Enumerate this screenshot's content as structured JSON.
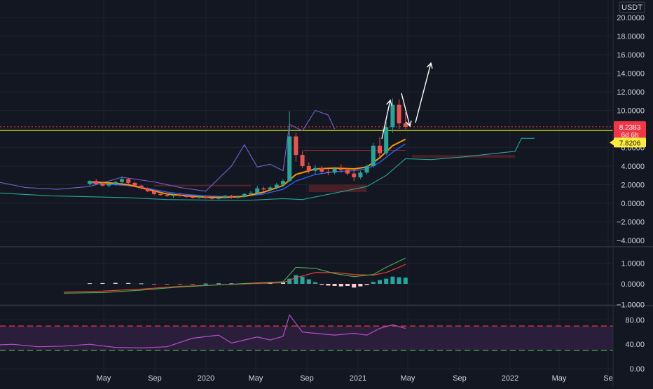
{
  "currency": "USDT",
  "colors": {
    "background": "#131722",
    "grid": "#1e222d",
    "up": "#26a69a",
    "down": "#ef5350",
    "ma": "#ff9800",
    "bb": "#7b61cf",
    "band": "#8b2a2a",
    "baseline": "#cccc00",
    "price_tag": "#f23645",
    "baseline_tag": "#ffeb3b",
    "macd_line": "#4caf50",
    "signal_line": "#f44336",
    "rsi_line": "#b34fc7",
    "rsi_band": "#2a1e3a",
    "rsi_upper": "#f23645",
    "rsi_lower": "#4caf50"
  },
  "time_labels": [
    "May",
    "Sep",
    "2020",
    "May",
    "Sep",
    "2021",
    "May",
    "Sep",
    "2022",
    "May",
    "Se"
  ],
  "price_tag": {
    "value": "8.2383",
    "countdown": "6d 6h"
  },
  "baseline_tag": {
    "value": "7.8206"
  },
  "chart_data": [
    {
      "type": "candlestick",
      "pane": "price",
      "y_ticks": [
        "20.0000",
        "18.0000",
        "16.0000",
        "14.0000",
        "12.0000",
        "10.0000",
        "6.0000",
        "4.0000",
        "2.0000",
        "0.0000",
        "−2.0000",
        "−4.0000"
      ],
      "ylim": [
        -4,
        21
      ],
      "last_price": 8.2383,
      "baseline": 7.8206,
      "candles": [
        [
          0,
          2.1,
          2.5,
          1.9,
          2.4
        ],
        [
          1,
          2.4,
          2.6,
          2.0,
          2.1
        ],
        [
          2,
          2.1,
          2.3,
          1.8,
          1.9
        ],
        [
          3,
          1.9,
          2.2,
          1.7,
          2.1
        ],
        [
          4,
          2.1,
          2.4,
          1.9,
          2.3
        ],
        [
          5,
          2.3,
          2.9,
          2.1,
          2.6
        ],
        [
          6,
          2.6,
          2.7,
          2.0,
          2.2
        ],
        [
          7,
          2.2,
          2.3,
          1.8,
          1.9
        ],
        [
          8,
          1.9,
          2.0,
          1.5,
          1.6
        ],
        [
          9,
          1.6,
          1.7,
          1.2,
          1.3
        ],
        [
          10,
          1.3,
          1.4,
          0.9,
          1.0
        ],
        [
          11,
          1.0,
          1.2,
          0.8,
          0.9
        ],
        [
          12,
          0.9,
          1.1,
          0.7,
          0.8
        ],
        [
          13,
          0.8,
          1.0,
          0.6,
          0.9
        ],
        [
          14,
          0.9,
          1.1,
          0.7,
          0.8
        ],
        [
          15,
          0.8,
          0.9,
          0.6,
          0.7
        ],
        [
          16,
          0.7,
          0.9,
          0.5,
          0.6
        ],
        [
          17,
          0.6,
          0.8,
          0.5,
          0.7
        ],
        [
          18,
          0.7,
          0.8,
          0.5,
          0.6
        ],
        [
          19,
          0.6,
          0.7,
          0.4,
          0.5
        ],
        [
          20,
          0.5,
          0.7,
          0.4,
          0.6
        ],
        [
          21,
          0.6,
          0.9,
          0.5,
          0.8
        ],
        [
          22,
          0.8,
          0.9,
          0.5,
          0.6
        ],
        [
          23,
          0.6,
          0.8,
          0.5,
          0.7
        ],
        [
          24,
          0.7,
          1.1,
          0.6,
          1.0
        ],
        [
          25,
          1.0,
          1.3,
          0.8,
          1.1
        ],
        [
          26,
          1.1,
          1.9,
          1.0,
          1.6
        ],
        [
          27,
          1.6,
          1.8,
          1.3,
          1.5
        ],
        [
          28,
          1.5,
          1.9,
          1.3,
          1.7
        ],
        [
          29,
          1.7,
          2.2,
          1.5,
          2.0
        ],
        [
          30,
          2.0,
          2.6,
          1.8,
          2.4
        ],
        [
          31,
          2.4,
          9.9,
          2.3,
          7.2
        ],
        [
          32,
          7.2,
          7.6,
          4.5,
          5.2
        ],
        [
          33,
          5.2,
          5.6,
          3.8,
          4.0
        ],
        [
          34,
          4.0,
          4.4,
          3.2,
          3.5
        ],
        [
          35,
          3.5,
          4.1,
          3.1,
          3.8
        ],
        [
          36,
          3.8,
          4.0,
          3.2,
          3.4
        ],
        [
          37,
          3.4,
          3.7,
          3.0,
          3.3
        ],
        [
          38,
          3.3,
          3.9,
          3.1,
          3.7
        ],
        [
          39,
          3.7,
          4.2,
          3.3,
          3.6
        ],
        [
          40,
          3.6,
          3.8,
          3.0,
          3.2
        ],
        [
          41,
          3.2,
          3.6,
          2.4,
          2.8
        ],
        [
          42,
          2.8,
          3.5,
          2.6,
          3.3
        ],
        [
          43,
          3.3,
          4.2,
          3.1,
          4.0
        ],
        [
          44,
          4.0,
          6.5,
          3.8,
          6.2
        ],
        [
          45,
          6.2,
          7.1,
          5.0,
          5.4
        ],
        [
          46,
          5.4,
          8.8,
          5.2,
          8.2
        ],
        [
          47,
          8.2,
          11.3,
          7.6,
          10.6
        ],
        [
          48,
          10.6,
          11.2,
          8.0,
          8.6
        ],
        [
          49,
          8.6,
          9.8,
          8.0,
          8.24
        ]
      ],
      "ma": [
        [
          0,
          2.3
        ],
        [
          3,
          2.2
        ],
        [
          6,
          2.0
        ],
        [
          9,
          1.5
        ],
        [
          12,
          1.0
        ],
        [
          15,
          0.8
        ],
        [
          18,
          0.65
        ],
        [
          21,
          0.62
        ],
        [
          24,
          0.75
        ],
        [
          27,
          1.2
        ],
        [
          30,
          1.9
        ],
        [
          32,
          3.1
        ],
        [
          35,
          3.7
        ],
        [
          38,
          3.8
        ],
        [
          41,
          3.7
        ],
        [
          43,
          3.9
        ],
        [
          45,
          4.9
        ],
        [
          47,
          6.2
        ],
        [
          49,
          6.9
        ]
      ],
      "ma2": [
        [
          0,
          2.1
        ],
        [
          3,
          2.05
        ],
        [
          6,
          1.9
        ],
        [
          9,
          1.6
        ],
        [
          12,
          1.2
        ],
        [
          15,
          0.95
        ],
        [
          18,
          0.8
        ],
        [
          21,
          0.72
        ],
        [
          24,
          0.75
        ],
        [
          27,
          1.0
        ],
        [
          30,
          1.5
        ],
        [
          32,
          2.4
        ],
        [
          35,
          3.1
        ],
        [
          38,
          3.4
        ],
        [
          41,
          3.5
        ],
        [
          43,
          3.7
        ],
        [
          45,
          4.4
        ],
        [
          47,
          5.5
        ],
        [
          49,
          6.4
        ]
      ],
      "bb_upper": [
        [
          -24,
          2.1
        ],
        [
          -20,
          1.6
        ],
        [
          -15,
          2.4
        ],
        [
          -10,
          1.7
        ],
        [
          -5,
          1.5
        ],
        [
          0,
          1.8
        ],
        [
          5,
          2.8
        ],
        [
          10,
          2.3
        ],
        [
          14,
          1.7
        ],
        [
          18,
          1.3
        ],
        [
          22,
          4.0
        ],
        [
          24,
          6.3
        ],
        [
          26,
          3.9
        ],
        [
          28,
          4.2
        ],
        [
          30,
          3.5
        ],
        [
          31,
          8.5
        ],
        [
          33,
          7.8
        ],
        [
          35,
          10.0
        ],
        [
          37,
          9.5
        ],
        [
          38,
          8.0
        ]
      ],
      "bb_lower": [
        [
          -14,
          1.1
        ],
        [
          -6,
          0.8
        ],
        [
          0,
          0.7
        ],
        [
          6,
          0.6
        ],
        [
          12,
          0.4
        ],
        [
          18,
          0.35
        ],
        [
          24,
          0.3
        ],
        [
          30,
          0.5
        ],
        [
          33,
          0.4
        ],
        [
          38,
          1.1
        ],
        [
          43,
          1.8
        ],
        [
          46,
          3.0
        ],
        [
          49,
          4.8
        ],
        [
          53,
          4.7
        ],
        [
          58,
          5.0
        ],
        [
          62,
          5.3
        ],
        [
          66,
          5.6
        ],
        [
          67,
          7.0
        ],
        [
          69,
          7.0
        ]
      ]
    },
    {
      "type": "bar+line",
      "pane": "macd",
      "y_ticks": [
        "1.0000",
        "0.0000",
        "−1.0000"
      ],
      "ylim": [
        -1.1,
        1.5
      ],
      "histogram": [
        [
          0,
          0.03
        ],
        [
          2,
          0.04
        ],
        [
          4,
          0.05
        ],
        [
          6,
          0.04
        ],
        [
          8,
          0.02
        ],
        [
          10,
          -0.02
        ],
        [
          12,
          -0.03
        ],
        [
          14,
          -0.02
        ],
        [
          16,
          -0.01
        ],
        [
          18,
          0.01
        ],
        [
          20,
          0.02
        ],
        [
          22,
          0.02
        ],
        [
          24,
          0.03
        ],
        [
          26,
          0.04
        ],
        [
          28,
          0.07
        ],
        [
          30,
          0.1
        ],
        [
          31,
          0.25
        ],
        [
          32,
          0.42
        ],
        [
          33,
          0.35
        ],
        [
          34,
          0.22
        ],
        [
          35,
          0.08
        ],
        [
          36,
          -0.04
        ],
        [
          37,
          -0.08
        ],
        [
          38,
          -0.1
        ],
        [
          39,
          -0.12
        ],
        [
          40,
          -0.1
        ],
        [
          41,
          -0.18
        ],
        [
          42,
          -0.12
        ],
        [
          43,
          -0.05
        ],
        [
          44,
          0.1
        ],
        [
          45,
          0.18
        ],
        [
          46,
          0.25
        ],
        [
          47,
          0.35
        ],
        [
          48,
          0.32
        ],
        [
          49,
          0.3
        ]
      ],
      "macd_line": [
        [
          -4,
          -0.45
        ],
        [
          2,
          -0.42
        ],
        [
          8,
          -0.3
        ],
        [
          14,
          -0.15
        ],
        [
          20,
          -0.05
        ],
        [
          26,
          0.05
        ],
        [
          30,
          0.1
        ],
        [
          32,
          0.8
        ],
        [
          35,
          0.75
        ],
        [
          38,
          0.5
        ],
        [
          41,
          0.35
        ],
        [
          44,
          0.45
        ],
        [
          46,
          0.8
        ],
        [
          48,
          1.1
        ],
        [
          49,
          1.25
        ]
      ],
      "signal_line": [
        [
          -4,
          -0.4
        ],
        [
          2,
          -0.35
        ],
        [
          8,
          -0.25
        ],
        [
          14,
          -0.12
        ],
        [
          20,
          -0.05
        ],
        [
          26,
          0.02
        ],
        [
          30,
          0.05
        ],
        [
          32,
          0.3
        ],
        [
          35,
          0.55
        ],
        [
          38,
          0.55
        ],
        [
          41,
          0.45
        ],
        [
          44,
          0.42
        ],
        [
          46,
          0.55
        ],
        [
          48,
          0.8
        ],
        [
          49,
          0.95
        ]
      ]
    },
    {
      "type": "line",
      "pane": "rsi",
      "y_ticks": [
        "80.00",
        "40.00",
        "0.00"
      ],
      "ylim": [
        0,
        95
      ],
      "upper": 70,
      "lower": 30,
      "rsi": [
        [
          -16,
          38
        ],
        [
          -12,
          40
        ],
        [
          -8,
          36
        ],
        [
          -4,
          37
        ],
        [
          0,
          40
        ],
        [
          4,
          35
        ],
        [
          8,
          34
        ],
        [
          12,
          36
        ],
        [
          16,
          50
        ],
        [
          20,
          55
        ],
        [
          22,
          42
        ],
        [
          26,
          52
        ],
        [
          28,
          47
        ],
        [
          30,
          53
        ],
        [
          31,
          88
        ],
        [
          33,
          60
        ],
        [
          35,
          58
        ],
        [
          38,
          55
        ],
        [
          41,
          58
        ],
        [
          43,
          55
        ],
        [
          45,
          66
        ],
        [
          47,
          72
        ],
        [
          49,
          66
        ]
      ]
    }
  ]
}
